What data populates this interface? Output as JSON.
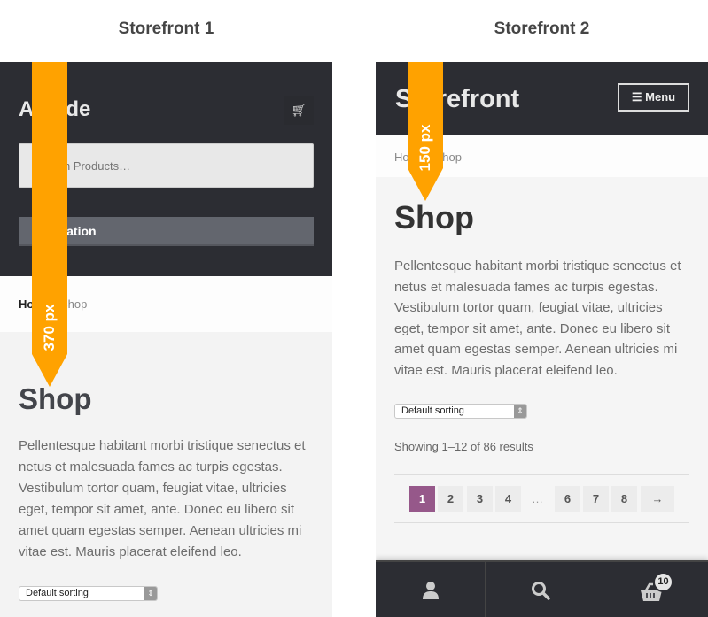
{
  "captions": {
    "left": "Storefront 1",
    "right": "Storefront 2"
  },
  "left": {
    "logo": "Arcade",
    "cart_icon": "cart-icon",
    "search_placeholder": "Search Products…",
    "nav_button": "Navigation",
    "breadcrumb": {
      "home": "Home",
      "sep": "/",
      "current": "Shop"
    },
    "title": "Shop",
    "description": "Pellentesque habitant morbi tristique senectus et netus et malesuada fames ac turpis egestas. Vestibulum tortor quam, feugiat vitae, ultricies eget, tempor sit amet, ante. Donec eu libero sit amet quam egestas semper. Aenean ultricies mi vitae est. Mauris placerat eleifend leo.",
    "sorting": "Default sorting",
    "banner": "370 px"
  },
  "right": {
    "logo": "Storefront",
    "menu_button": "Menu",
    "breadcrumb": {
      "home": "Home",
      "sep": "/",
      "current": "Shop"
    },
    "title": "Shop",
    "description": "Pellentesque habitant morbi tristique senectus et netus et malesuada fames ac turpis egestas. Vestibulum tortor quam, feugiat vitae, ultricies eget, tempor sit amet, ante. Donec eu libero sit amet quam egestas semper. Aenean ultricies mi vitae est. Mauris placerat eleifend leo.",
    "sorting": "Default sorting",
    "result_count": "Showing 1–12 of 86 results",
    "pagination": {
      "pages": [
        "1",
        "2",
        "3",
        "4",
        "…",
        "6",
        "7",
        "8",
        "→"
      ],
      "current": "1"
    },
    "footer_bar": {
      "cart_count": "10",
      "icons": [
        "user-icon",
        "search-icon",
        "basket-icon"
      ]
    },
    "banner": "150 px"
  },
  "colors": {
    "header": "#2c2d33",
    "banner": "#ffa200",
    "active_page": "#96588a"
  }
}
